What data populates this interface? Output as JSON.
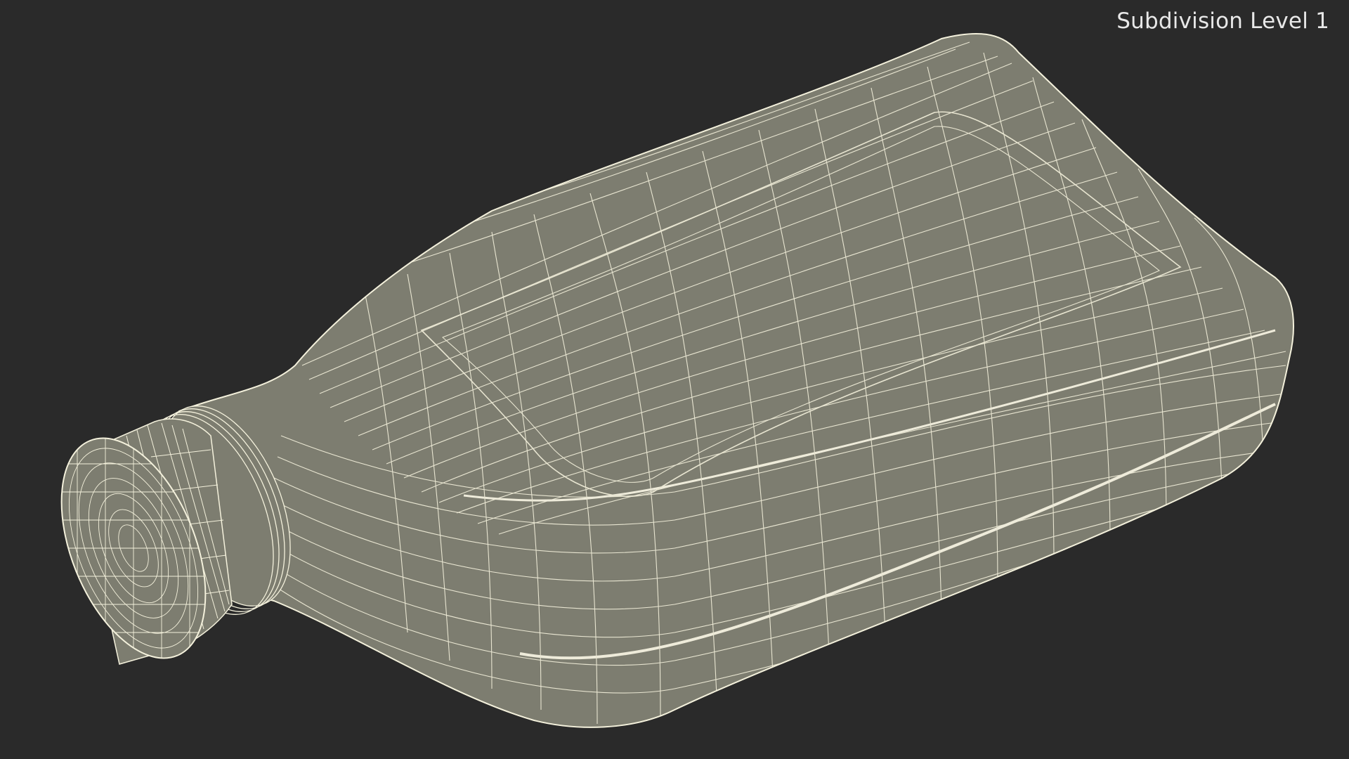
{
  "viewport": {
    "label": "Subdivision Level 1"
  },
  "model": {
    "subject": "plastic oil bottle wireframe",
    "fill_color": "#7d7d70",
    "wire_color": "#f4f1dc",
    "background_color": "#2a2a2a"
  }
}
